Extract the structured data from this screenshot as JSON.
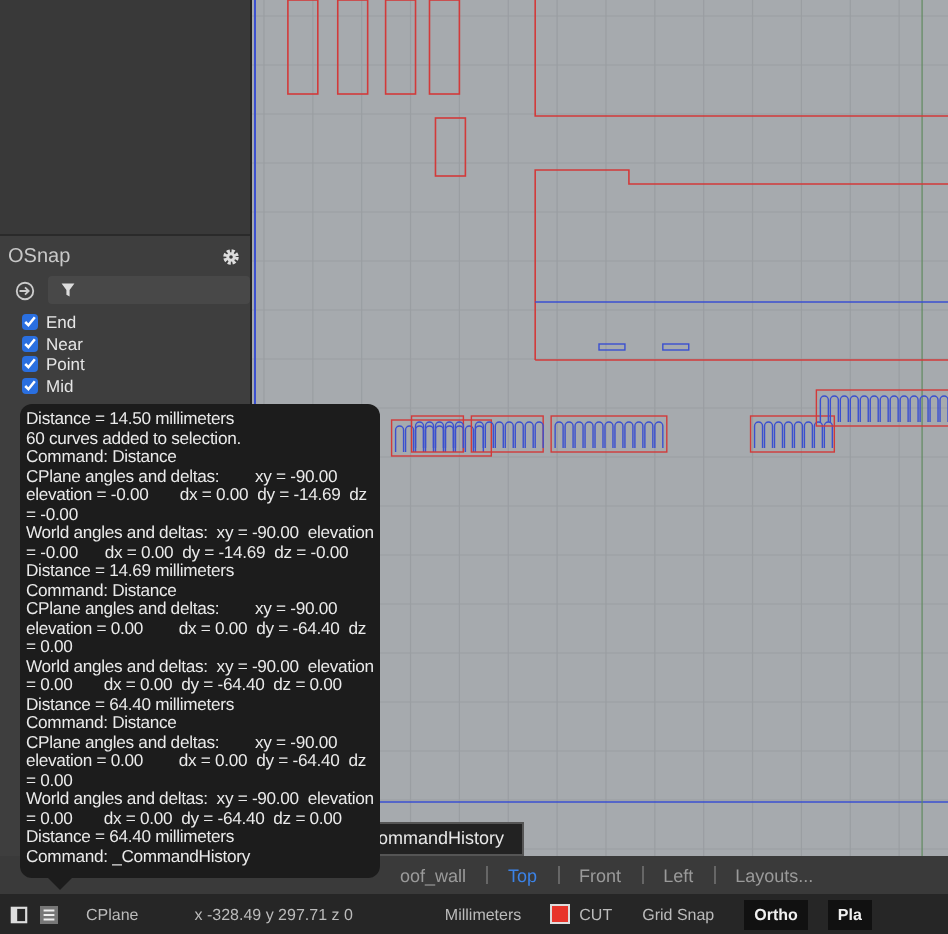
{
  "osnap": {
    "title": "OSnap",
    "options": [
      {
        "label": "End",
        "checked": true
      },
      {
        "label": "Near",
        "checked": true
      },
      {
        "label": "Point",
        "checked": true
      },
      {
        "label": "Mid",
        "checked": true
      }
    ]
  },
  "command_history": {
    "lines": [
      "Distance = 14.50 millimeters",
      "60 curves added to selection.",
      "Command: Distance",
      "CPlane angles and deltas:        xy = -90.00",
      "elevation = -0.00       dx = 0.00  dy = -14.69  dz",
      "= -0.00",
      "World angles and deltas:  xy = -90.00  elevation",
      "= -0.00      dx = 0.00  dy = -14.69  dz = -0.00",
      "Distance = 14.69 millimeters",
      "Command: Distance",
      "CPlane angles and deltas:        xy = -90.00",
      "elevation = 0.00        dx = 0.00  dy = -64.40  dz",
      "= 0.00",
      "World angles and deltas:  xy = -90.00  elevation",
      "= 0.00       dx = 0.00  dy = -64.40  dz = 0.00",
      "Distance = 64.40 millimeters",
      "Command: Distance",
      "CPlane angles and deltas:        xy = -90.00",
      "elevation = 0.00        dx = 0.00  dy = -64.40  dz",
      "= 0.00",
      "World angles and deltas:  xy = -90.00  elevation",
      "= 0.00       dx = 0.00  dy = -64.40  dz = 0.00",
      "Distance = 64.40 millimeters",
      "Command: _CommandHistory"
    ]
  },
  "tooltip": "ommandHistory",
  "viewport_tabs": [
    {
      "label": "oof_wall",
      "selected": false
    },
    {
      "label": "Top",
      "selected": true
    },
    {
      "label": "Front",
      "selected": false
    },
    {
      "label": "Left",
      "selected": false
    },
    {
      "label": "Layouts...",
      "selected": false
    }
  ],
  "status_bar": {
    "cplane": "CPlane",
    "coordinates": "x -328.49  y 297.71  z 0",
    "units": "Millimeters",
    "layer": {
      "name": "CUT",
      "color": "#e8352b"
    },
    "toggles": [
      {
        "label": "Grid Snap",
        "on": false
      },
      {
        "label": "Ortho",
        "on": true
      },
      {
        "label": "Pla",
        "on": true
      }
    ]
  }
}
